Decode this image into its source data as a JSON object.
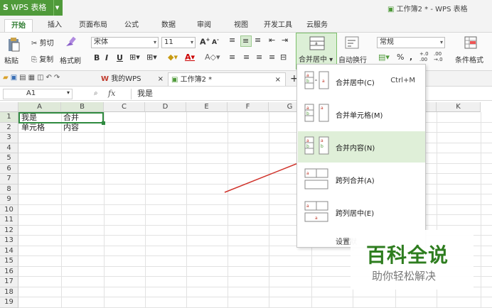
{
  "app": {
    "name": "WPS 表格",
    "window_title": "工作簿2 * - WPS 表格"
  },
  "ribbon_tabs": [
    "开始",
    "插入",
    "页面布局",
    "公式",
    "数据",
    "审阅",
    "视图",
    "开发工具",
    "云服务"
  ],
  "ribbon": {
    "cut": "剪切",
    "paste": "粘贴",
    "copy": "复制",
    "format_painter": "格式刷",
    "font_name": "宋体",
    "font_size": "11",
    "merge_center": "合并居中",
    "wrap_text": "自动换行",
    "number_format": "常规",
    "conditional_format": "条件格式",
    "bold": "B",
    "italic": "I",
    "underline": "U",
    "percent": "%",
    "comma": ","
  },
  "doc_tabs": {
    "home": "我的WPS",
    "current": "工作簿2 *",
    "add": "+"
  },
  "formula_bar": {
    "name_box": "A1",
    "fx": "fx",
    "value": "我是"
  },
  "columns": [
    "A",
    "B",
    "C",
    "D",
    "E",
    "F",
    "G",
    "K"
  ],
  "rows": [
    "1",
    "2",
    "3",
    "4",
    "5",
    "6",
    "7",
    "8",
    "9",
    "10",
    "11",
    "12",
    "13",
    "14",
    "15",
    "16",
    "17",
    "18",
    "19"
  ],
  "cells": {
    "A1": "我是",
    "B1": "合并",
    "A2": "单元格",
    "B2": "内容"
  },
  "merge_menu": {
    "items": [
      {
        "label": "合并居中(C)",
        "shortcut": "Ctrl+M"
      },
      {
        "label": "合并单元格(M)",
        "shortcut": ""
      },
      {
        "label": "合并内容(N)",
        "shortcut": ""
      },
      {
        "label": "跨列合并(A)",
        "shortcut": ""
      },
      {
        "label": "跨列居中(E)",
        "shortcut": ""
      }
    ],
    "footer": "设置默"
  },
  "watermark": {
    "title": "百科全说",
    "subtitle": "助你轻松解决"
  },
  "colors": {
    "accent": "#4f9a3a",
    "selection": "#2f8a3f",
    "highlight": "#dfefd8",
    "arrow": "#d0342c",
    "watermark": "#2e7d1f"
  }
}
